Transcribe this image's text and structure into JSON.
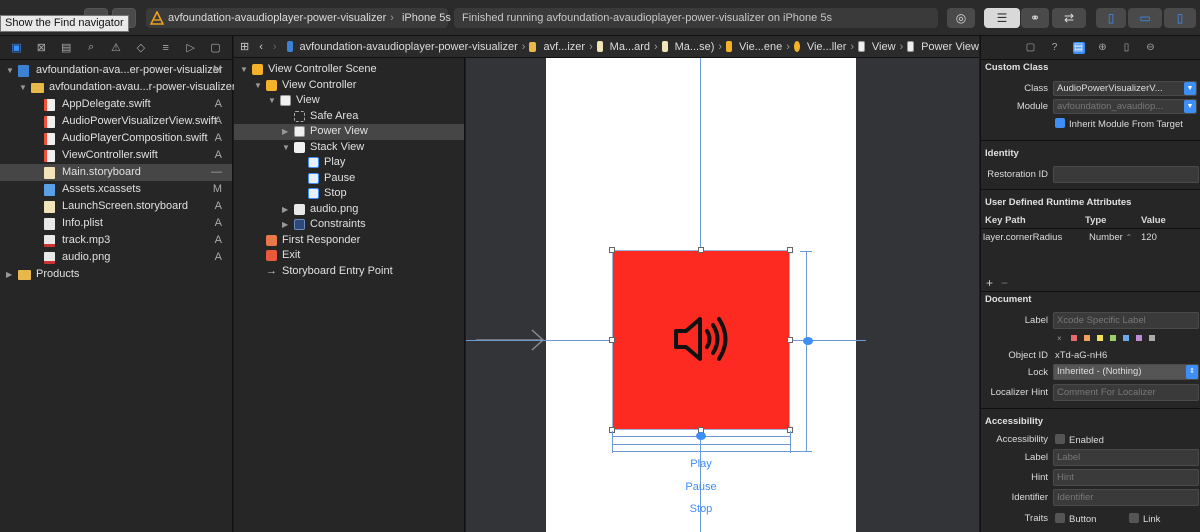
{
  "tooltip": "Show the Find navigator",
  "toolbar": {
    "scheme_name": "avfoundation-avaudioplayer-power-visualizer",
    "device": "iPhone 5s",
    "status": "Finished running avfoundation-avaudioplayer-power-visualizer on iPhone 5s"
  },
  "navigator": {
    "files": [
      {
        "name": "avfoundation-ava...er-power-visualizer",
        "badge": "M",
        "indent": 0,
        "tri": "▼",
        "icon": "project-icon"
      },
      {
        "name": "avfoundation-avau...r-power-visualizer",
        "badge": "",
        "indent": 1,
        "tri": "▼",
        "icon": "folder-icon"
      },
      {
        "name": "AppDelegate.swift",
        "badge": "A",
        "indent": 2,
        "tri": "",
        "icon": "swift-file-icon"
      },
      {
        "name": "AudioPowerVisualizerView.swift",
        "badge": "A",
        "indent": 2,
        "tri": "",
        "icon": "swift-file-icon"
      },
      {
        "name": "AudioPlayerComposition.swift",
        "badge": "A",
        "indent": 2,
        "tri": "",
        "icon": "swift-file-icon"
      },
      {
        "name": "ViewController.swift",
        "badge": "A",
        "indent": 2,
        "tri": "",
        "icon": "swift-file-icon"
      },
      {
        "name": "Main.storyboard",
        "badge": "—",
        "indent": 2,
        "tri": "",
        "icon": "storyboard-file-icon",
        "selected": true
      },
      {
        "name": "Assets.xcassets",
        "badge": "M",
        "indent": 2,
        "tri": "",
        "icon": "assets-icon"
      },
      {
        "name": "LaunchScreen.storyboard",
        "badge": "A",
        "indent": 2,
        "tri": "",
        "icon": "storyboard-file-icon"
      },
      {
        "name": "Info.plist",
        "badge": "A",
        "indent": 2,
        "tri": "",
        "icon": "plist-file-icon"
      },
      {
        "name": "track.mp3",
        "badge": "A",
        "indent": 2,
        "tri": "",
        "icon": "mp3-file-icon"
      },
      {
        "name": "audio.png",
        "badge": "A",
        "indent": 2,
        "tri": "",
        "icon": "png-file-icon"
      },
      {
        "name": "Products",
        "badge": "",
        "indent": 0,
        "tri": "▶",
        "icon": "folder-icon"
      }
    ]
  },
  "jumpbar": {
    "items": [
      "avfoundation-avaudioplayer-power-visualizer",
      "avf...izer",
      "Ma...ard",
      "Ma...se)",
      "Vie...ene",
      "Vie...ller",
      "View",
      "Power View"
    ]
  },
  "outline": {
    "rows": [
      {
        "name": "View Controller Scene",
        "indent": 0,
        "tri": "▼",
        "icon": "scene-icon"
      },
      {
        "name": "View Controller",
        "indent": 1,
        "tri": "▼",
        "icon": "view-controller-icon"
      },
      {
        "name": "View",
        "indent": 2,
        "tri": "▼",
        "icon": "view-icon"
      },
      {
        "name": "Safe Area",
        "indent": 3,
        "tri": "",
        "icon": "safe-area-icon"
      },
      {
        "name": "Power View",
        "indent": 3,
        "tri": "▶",
        "icon": "view-icon",
        "selected": true
      },
      {
        "name": "Stack View",
        "indent": 3,
        "tri": "▼",
        "icon": "stack-view-icon"
      },
      {
        "name": "Play",
        "indent": 4,
        "tri": "",
        "icon": "button-icon"
      },
      {
        "name": "Pause",
        "indent": 4,
        "tri": "",
        "icon": "button-icon"
      },
      {
        "name": "Stop",
        "indent": 4,
        "tri": "",
        "icon": "button-icon"
      },
      {
        "name": "audio.png",
        "indent": 3,
        "tri": "▶",
        "icon": "image-icon"
      },
      {
        "name": "Constraints",
        "indent": 3,
        "tri": "▶",
        "icon": "constraints-icon"
      },
      {
        "name": "First Responder",
        "indent": 1,
        "tri": "",
        "icon": "first-responder-icon"
      },
      {
        "name": "Exit",
        "indent": 1,
        "tri": "",
        "icon": "exit-icon"
      },
      {
        "name": "Storyboard Entry Point",
        "indent": 1,
        "tri": "",
        "icon": "entry-arrow-icon"
      }
    ]
  },
  "canvas": {
    "buttons": [
      "Play",
      "Pause",
      "Stop"
    ],
    "power_view_color": "#fc2a21",
    "icon": "speaker-icon"
  },
  "inspector": {
    "custom_class": {
      "title": "Custom Class",
      "class_label": "Class",
      "class_value": "AudioPowerVisualizerV...",
      "module_label": "Module",
      "module_placeholder": "avfoundation_avaudiop...",
      "inherit_label": "Inherit Module From Target"
    },
    "identity": {
      "title": "Identity",
      "restoration_label": "Restoration ID"
    },
    "runtime_attrs": {
      "title": "User Defined Runtime Attributes",
      "headers": [
        "Key Path",
        "Type",
        "Value"
      ],
      "row": {
        "key": "layer.cornerRadius",
        "type": "Number",
        "value": "120"
      }
    },
    "document": {
      "title": "Document",
      "label_label": "Label",
      "label_placeholder": "Xcode Specific Label",
      "object_id_label": "Object ID",
      "object_id": "xTd-aG-nH6",
      "lock_label": "Lock",
      "lock_value": "Inherited - (Nothing)",
      "localizer_label": "Localizer Hint",
      "localizer_placeholder": "Comment For Localizer",
      "swatches": [
        "#e86a6a",
        "#f0a060",
        "#f0e060",
        "#9ad06a",
        "#6aa8e8",
        "#c08ad8",
        "#aaaaaa"
      ]
    },
    "accessibility": {
      "title": "Accessibility",
      "accessibility_label": "Accessibility",
      "enabled_label": "Enabled",
      "label_label": "Label",
      "label_placeholder": "Label",
      "hint_label": "Hint",
      "hint_placeholder": "Hint",
      "identifier_label": "Identifier",
      "identifier_placeholder": "Identifier",
      "traits_label": "Traits",
      "trait_button": "Button",
      "trait_link": "Link"
    }
  }
}
